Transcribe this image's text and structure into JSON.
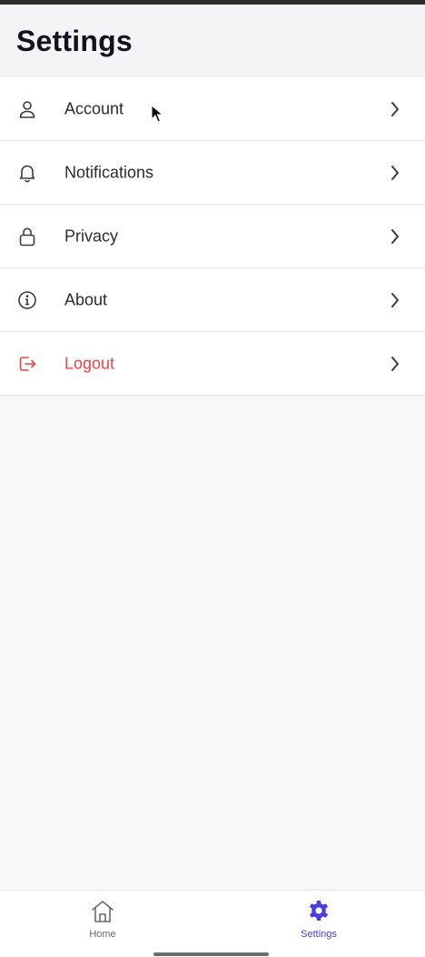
{
  "header": {
    "title": "Settings"
  },
  "menu": {
    "items": [
      {
        "label": "Account",
        "icon": "user-icon"
      },
      {
        "label": "Notifications",
        "icon": "bell-icon"
      },
      {
        "label": "Privacy",
        "icon": "lock-icon"
      },
      {
        "label": "About",
        "icon": "info-icon"
      },
      {
        "label": "Logout",
        "icon": "logout-icon"
      }
    ]
  },
  "bottom_nav": {
    "home_label": "Home",
    "settings_label": "Settings"
  },
  "colors": {
    "accent": "#4a40d8",
    "danger": "#e0484a",
    "background": "#f8f8fa"
  }
}
